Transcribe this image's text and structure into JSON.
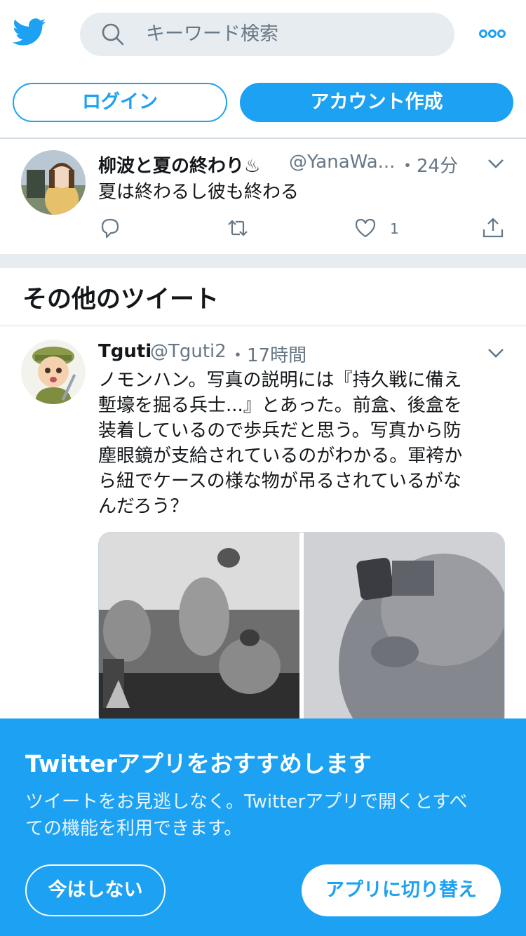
{
  "header": {
    "search_placeholder": "キーワード検索",
    "login_label": "ログイン",
    "signup_label": "アカウント作成"
  },
  "tweets": [
    {
      "name": "柳波と夏の終わり♨",
      "handle": "@YanaWa...",
      "time": "・24分",
      "text": "夏は終わるし彼も終わる",
      "like_count": "1"
    },
    {
      "name": "Tguti",
      "handle": "@Tguti2",
      "time": "・17時間",
      "text_lines": [
        "ノモンハン。写真の説明には『持久戦に備え",
        "塹壕を掘る兵士...』とあった。前盒、後盒を",
        "装着しているので歩兵だと思う。写真から防",
        "塵眼鏡が支給されているのがわかる。軍袴か",
        "ら紐でケースの様な物が吊るされているがな",
        "んだろう？"
      ]
    }
  ],
  "section_title": "その他のツイート",
  "banner": {
    "title": "Twitterアプリをおすすめします",
    "desc_line1": "ツイートをお見逃しなく。Twitterアプリで開くとすべ",
    "desc_line2": "ての機能を利用できます。",
    "not_now_label": "今はしない",
    "switch_label": "アプリに切り替え"
  },
  "colors": {
    "accent": "#1da1f2",
    "secondary_text": "#657786",
    "band": "#e6ecf0"
  },
  "icons": [
    "twitter-bird-icon",
    "search-icon",
    "more-icon",
    "chevron-down-icon",
    "reply-icon",
    "retweet-icon",
    "like-icon",
    "share-icon"
  ]
}
